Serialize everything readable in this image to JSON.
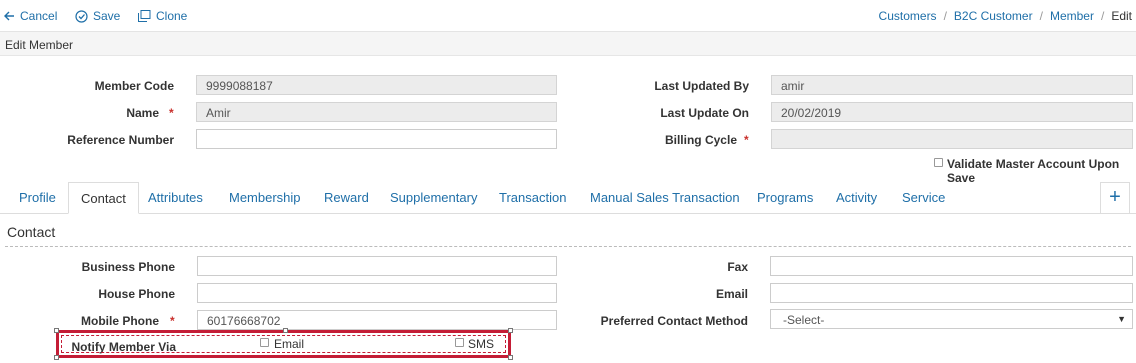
{
  "toolbar": {
    "cancel_label": "Cancel",
    "save_label": "Save",
    "clone_label": "Clone"
  },
  "breadcrumb": {
    "items": [
      "Customers",
      "B2C Customer",
      "Member"
    ],
    "current": "Edit"
  },
  "subheader": {
    "title": "Edit Member"
  },
  "form": {
    "member_code": {
      "label": "Member Code",
      "value": "9999088187"
    },
    "name": {
      "label": "Name",
      "value": "Amir",
      "required_mark": "*"
    },
    "reference_number": {
      "label": "Reference Number",
      "value": ""
    },
    "last_updated_by": {
      "label": "Last Updated By",
      "value": "amir"
    },
    "last_update_on": {
      "label": "Last Update On",
      "value": "20/02/2019"
    },
    "billing_cycle": {
      "label": "Billing Cycle",
      "value": "",
      "required_mark": "*"
    },
    "validate_master": {
      "label": "Validate Master Account Upon Save",
      "checked": false
    }
  },
  "tabs": {
    "items": [
      "Profile",
      "Contact",
      "Attributes",
      "Membership",
      "Reward",
      "Supplementary",
      "Transaction",
      "Manual Sales Transaction",
      "Programs",
      "Activity",
      "Service"
    ],
    "active": "Contact",
    "add_label": "+"
  },
  "contact": {
    "section_title": "Contact",
    "business_phone": {
      "label": "Business Phone",
      "value": ""
    },
    "house_phone": {
      "label": "House Phone",
      "value": ""
    },
    "mobile_phone": {
      "label": "Mobile Phone",
      "value": "60176668702",
      "required_mark": "*"
    },
    "fax": {
      "label": "Fax",
      "value": ""
    },
    "email": {
      "label": "Email",
      "value": ""
    },
    "preferred_contact_method": {
      "label": "Preferred Contact Method",
      "selected": "-Select-"
    },
    "notify_member_via": {
      "label": "Notify Member Via",
      "options": [
        {
          "label": "Email",
          "checked": false
        },
        {
          "label": "SMS",
          "checked": false
        }
      ]
    }
  },
  "colors": {
    "link": "#1f6fa8",
    "required": "#c9302c",
    "highlight": "#c41d36"
  }
}
